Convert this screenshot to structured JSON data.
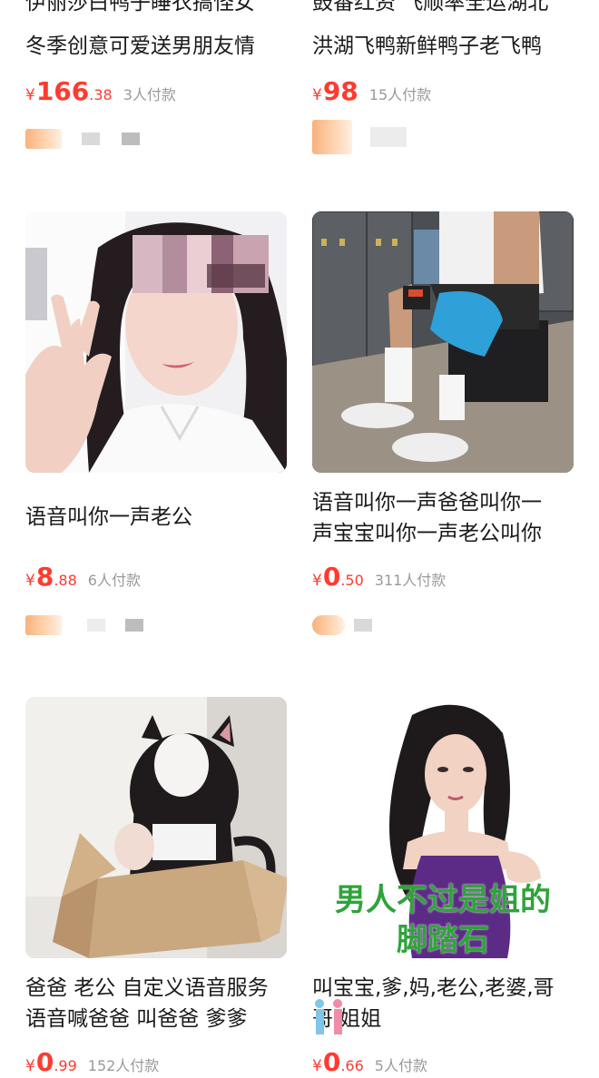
{
  "products": [
    {
      "title_line1": "伊丽莎白鸭子睡衣搞怪女",
      "title_line2": "冬季创意可爱送男朋友情",
      "price_int": "166",
      "price_dec": ".38",
      "currency": "¥",
      "sold": "3人付款"
    },
    {
      "title_line1": "鼓番红资 飞顺率全运湖北",
      "title_line2": "洪湖飞鸭新鲜鸭子老飞鸭",
      "price_int": "98",
      "price_dec": "",
      "currency": "¥",
      "sold": "15人付款"
    },
    {
      "title_line1": "语音叫你一声老公",
      "title_line2": "",
      "price_int": "8",
      "price_dec": ".88",
      "currency": "¥",
      "sold": "6人付款",
      "image": "selfie-girl-peace-sign"
    },
    {
      "title_line1": "语音叫你一声爸爸叫你一",
      "title_line2": "声宝宝叫你一声老公叫你",
      "price_int": "0",
      "price_dec": ".50",
      "currency": "¥",
      "sold": "311人付款",
      "image": "gym-locker-room-photo"
    },
    {
      "title_line1": "爸爸 老公 自定义语音服务",
      "title_line2": "语音喊爸爸 叫爸爸 爹爹",
      "price_int": "0",
      "price_dec": ".99",
      "currency": "¥",
      "sold": "152人付款",
      "image": "cat-ear-cosplay-in-box"
    },
    {
      "title_line1": "叫宝宝,爹,妈,老公,老婆,哥",
      "title_line2": "哥,姐姐",
      "price_int": "0",
      "price_dec": ".66",
      "currency": "¥",
      "sold": "5人付款",
      "image": "cartoon-woman-purple-dress",
      "image_caption_line1": "男人不过是姐的",
      "image_caption_line2": "脚踏石"
    }
  ],
  "colors": {
    "price": "#ff3b2f",
    "sold": "#9a9a9a",
    "caption_green": "#2fa33a"
  }
}
